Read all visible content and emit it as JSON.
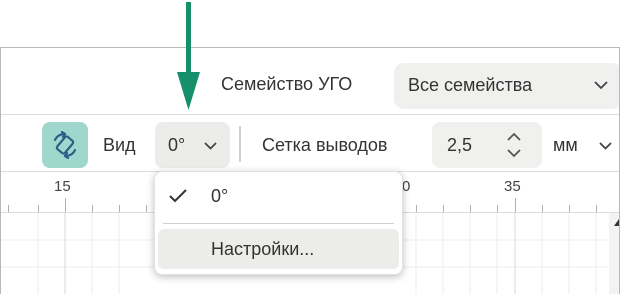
{
  "symbol_family": {
    "label": "Семейство УГО",
    "value": "Все семейства"
  },
  "toolbar": {
    "rotate_icon": "rotate-icon",
    "view_label": "Вид",
    "view_value": "0°",
    "grid_label": "Сетка выводов",
    "grid_value": "2,5",
    "unit_value": "мм"
  },
  "ruler": {
    "labels": [
      "15",
      "0",
      "35"
    ]
  },
  "dropdown": {
    "options": [
      {
        "label": "0°",
        "selected": true
      },
      {
        "label": "Настройки..."
      }
    ]
  },
  "colors": {
    "annotation_arrow": "#15906a",
    "accent_button": "#9fd7cc"
  }
}
